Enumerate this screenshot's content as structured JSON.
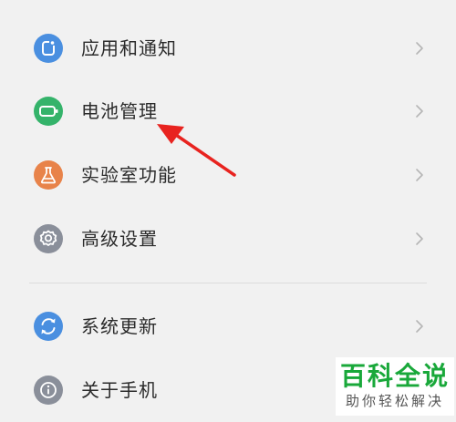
{
  "settings": {
    "items": [
      {
        "label": "应用和通知",
        "icon": "apps-icon",
        "icon_color": "#4a8fe0"
      },
      {
        "label": "电池管理",
        "icon": "battery-icon",
        "icon_color": "#34b36a"
      },
      {
        "label": "实验室功能",
        "icon": "flask-icon",
        "icon_color": "#e8834a"
      },
      {
        "label": "高级设置",
        "icon": "gear-icon",
        "icon_color": "#8a8f9a"
      },
      {
        "label": "系统更新",
        "icon": "refresh-icon",
        "icon_color": "#4a8fe0"
      },
      {
        "label": "关于手机",
        "icon": "info-icon",
        "icon_color": "#8a8f9a"
      }
    ]
  },
  "annotation": {
    "arrow_color": "#e8231f"
  },
  "watermark": {
    "brand": "百科全说",
    "slogan": "助你轻松解决",
    "brand_color": "#19a83a"
  }
}
